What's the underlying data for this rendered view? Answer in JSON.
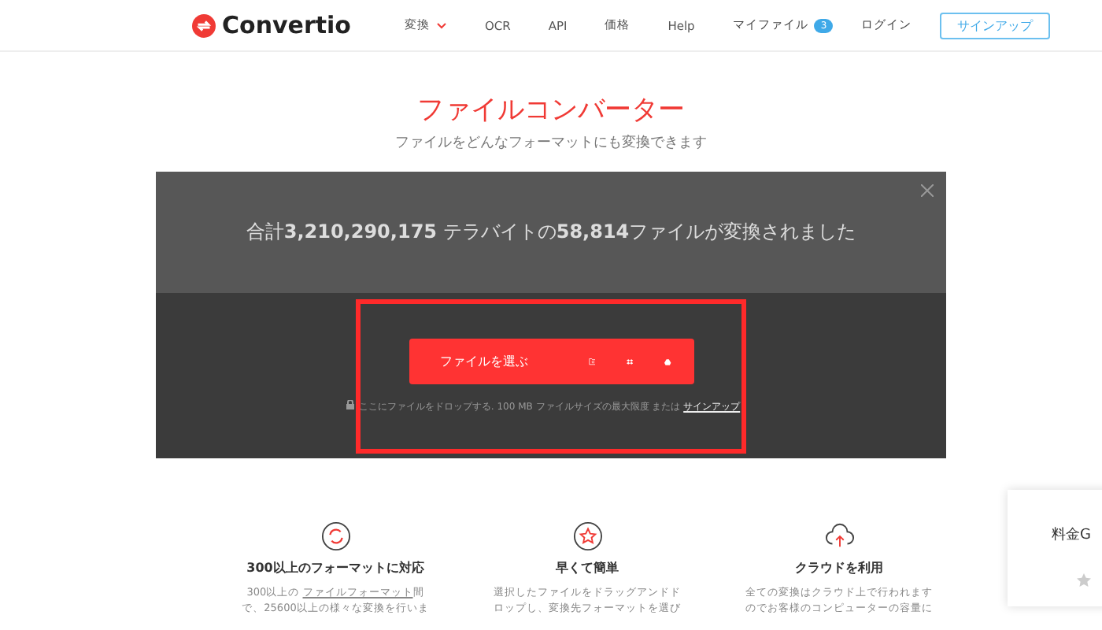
{
  "header": {
    "logo": "Convertio",
    "nav": [
      {
        "label": "変換",
        "dropdown": true
      },
      {
        "label": "OCR",
        "dropdown": false
      },
      {
        "label": "API",
        "dropdown": false
      },
      {
        "label": "価格",
        "dropdown": false
      },
      {
        "label": "Help",
        "dropdown": false
      }
    ],
    "my_files": {
      "label": "マイファイル",
      "count": "3"
    },
    "login": "ログイン",
    "signup": "サインアップ"
  },
  "hero": {
    "title": "ファイルコンバーター",
    "subtitle": "ファイルをどんなフォーマットにも変換できます"
  },
  "panel": {
    "stats": "合計**3,210,290,175** テラバイトの**58,814**ファイルが変換されました",
    "choose_button": "ファイルを選ぶ",
    "note": "ここにファイルをドロップする. 100 MB ファイルサイズの最大限度 または",
    "note_link": "サインアップ"
  },
  "features": [
    {
      "kind": "formats",
      "title": "300以上のフォーマットに対応",
      "lines": [
        "300以上の",
        "ファイルフォーマット",
        "間",
        "で、25600以上の様々な変換を行いま"
      ]
    },
    {
      "kind": "fast",
      "title": "早くて簡単",
      "lines": [
        "選択したファイルをドラッグアンドド",
        "ロップし、変換先フォーマットを選び"
      ]
    },
    {
      "kind": "cloud",
      "title": "クラウドを利用",
      "lines": [
        "全ての変換はクラウド上で行われます",
        "のでお客様のコンピューターの容量に"
      ]
    }
  ],
  "side_card": {
    "text": "料金G"
  }
}
